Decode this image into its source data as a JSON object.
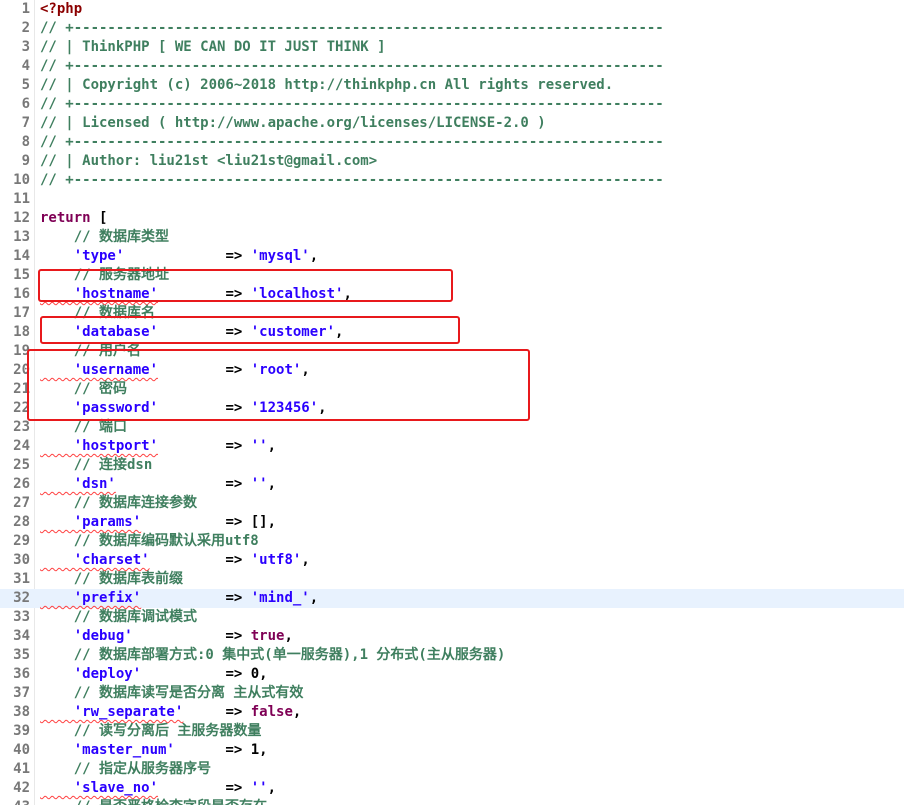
{
  "editor": {
    "current_line": 32,
    "lines": [
      {
        "n": "1",
        "t": [
          {
            "c": "php",
            "v": "<?php"
          }
        ]
      },
      {
        "n": "2",
        "t": [
          {
            "c": "com",
            "v": "// +----------------------------------------------------------------------"
          }
        ]
      },
      {
        "n": "3",
        "t": [
          {
            "c": "com",
            "v": "// | ThinkPHP [ WE CAN DO IT JUST THINK ]"
          }
        ]
      },
      {
        "n": "4",
        "t": [
          {
            "c": "com",
            "v": "// +----------------------------------------------------------------------"
          }
        ]
      },
      {
        "n": "5",
        "t": [
          {
            "c": "com",
            "v": "// | Copyright (c) 2006~2018 http://thinkphp.cn All rights reserved."
          }
        ]
      },
      {
        "n": "6",
        "t": [
          {
            "c": "com",
            "v": "// +----------------------------------------------------------------------"
          }
        ]
      },
      {
        "n": "7",
        "t": [
          {
            "c": "com",
            "v": "// | Licensed ( http://www.apache.org/licenses/LICENSE-2.0 )"
          }
        ]
      },
      {
        "n": "8",
        "t": [
          {
            "c": "com",
            "v": "// +----------------------------------------------------------------------"
          }
        ]
      },
      {
        "n": "9",
        "t": [
          {
            "c": "com",
            "v": "// | Author: liu21st <liu21st@gmail.com>"
          }
        ]
      },
      {
        "n": "10",
        "t": [
          {
            "c": "com",
            "v": "// +----------------------------------------------------------------------"
          }
        ]
      },
      {
        "n": "11",
        "t": []
      },
      {
        "n": "12",
        "t": [
          {
            "c": "kw",
            "v": "return"
          },
          {
            "c": "pl",
            "v": " ["
          }
        ]
      },
      {
        "n": "13",
        "t": [
          {
            "c": "com",
            "v": "    // 数据库类型"
          }
        ]
      },
      {
        "n": "14",
        "t": [
          {
            "c": "str",
            "v": "    'type'"
          },
          {
            "c": "op",
            "v": "            => "
          },
          {
            "c": "str",
            "v": "'mysql'"
          },
          {
            "c": "pl",
            "v": ","
          }
        ]
      },
      {
        "n": "15",
        "t": [
          {
            "c": "com",
            "v": "    // 服务器地址"
          }
        ]
      },
      {
        "n": "16",
        "t": [
          {
            "c": "str",
            "v": "    'hostname'"
          },
          {
            "c": "op",
            "v": "        => "
          },
          {
            "c": "str",
            "v": "'localhost'"
          },
          {
            "c": "pl",
            "v": ","
          }
        ]
      },
      {
        "n": "17",
        "t": [
          {
            "c": "com",
            "v": "    // 数据库名"
          }
        ]
      },
      {
        "n": "18",
        "t": [
          {
            "c": "str",
            "v": "    'database'"
          },
          {
            "c": "op",
            "v": "        => "
          },
          {
            "c": "str",
            "v": "'customer'"
          },
          {
            "c": "pl",
            "v": ","
          }
        ]
      },
      {
        "n": "19",
        "t": [
          {
            "c": "com",
            "v": "    // 用户名"
          }
        ]
      },
      {
        "n": "20",
        "t": [
          {
            "c": "str",
            "v": "    'username'"
          },
          {
            "c": "op",
            "v": "        => "
          },
          {
            "c": "str",
            "v": "'root'"
          },
          {
            "c": "pl",
            "v": ","
          }
        ]
      },
      {
        "n": "21",
        "t": [
          {
            "c": "com",
            "v": "    // 密码"
          }
        ]
      },
      {
        "n": "22",
        "t": [
          {
            "c": "str",
            "v": "    'password'"
          },
          {
            "c": "op",
            "v": "        => "
          },
          {
            "c": "str",
            "v": "'123456'"
          },
          {
            "c": "pl",
            "v": ","
          }
        ]
      },
      {
        "n": "23",
        "t": [
          {
            "c": "com",
            "v": "    // 端口"
          }
        ]
      },
      {
        "n": "24",
        "t": [
          {
            "c": "str",
            "v": "    'hostport'"
          },
          {
            "c": "op",
            "v": "        => "
          },
          {
            "c": "str",
            "v": "''"
          },
          {
            "c": "pl",
            "v": ","
          }
        ]
      },
      {
        "n": "25",
        "t": [
          {
            "c": "com",
            "v": "    // 连接dsn"
          }
        ]
      },
      {
        "n": "26",
        "t": [
          {
            "c": "str",
            "v": "    'dsn'"
          },
          {
            "c": "op",
            "v": "             => "
          },
          {
            "c": "str",
            "v": "''"
          },
          {
            "c": "pl",
            "v": ","
          }
        ]
      },
      {
        "n": "27",
        "t": [
          {
            "c": "com",
            "v": "    // 数据库连接参数"
          }
        ]
      },
      {
        "n": "28",
        "t": [
          {
            "c": "str",
            "v": "    'params'"
          },
          {
            "c": "op",
            "v": "          => "
          },
          {
            "c": "pl",
            "v": "[],"
          }
        ]
      },
      {
        "n": "29",
        "t": [
          {
            "c": "com",
            "v": "    // 数据库编码默认采用utf8"
          }
        ]
      },
      {
        "n": "30",
        "t": [
          {
            "c": "str",
            "v": "    'charset'"
          },
          {
            "c": "op",
            "v": "         => "
          },
          {
            "c": "str",
            "v": "'utf8'"
          },
          {
            "c": "pl",
            "v": ","
          }
        ]
      },
      {
        "n": "31",
        "t": [
          {
            "c": "com",
            "v": "    // 数据库表前缀"
          }
        ]
      },
      {
        "n": "32",
        "t": [
          {
            "c": "str",
            "v": "    'prefix'"
          },
          {
            "c": "op",
            "v": "          => "
          },
          {
            "c": "str",
            "v": "'mind_'"
          },
          {
            "c": "pl",
            "v": ","
          }
        ]
      },
      {
        "n": "33",
        "t": [
          {
            "c": "com",
            "v": "    // 数据库调试模式"
          }
        ]
      },
      {
        "n": "34",
        "t": [
          {
            "c": "str",
            "v": "    'debug'"
          },
          {
            "c": "op",
            "v": "           => "
          },
          {
            "c": "kw",
            "v": "true"
          },
          {
            "c": "pl",
            "v": ","
          }
        ]
      },
      {
        "n": "35",
        "t": [
          {
            "c": "com",
            "v": "    // 数据库部署方式:0 集中式(单一服务器),1 分布式(主从服务器)"
          }
        ]
      },
      {
        "n": "36",
        "t": [
          {
            "c": "str",
            "v": "    'deploy'"
          },
          {
            "c": "op",
            "v": "          => "
          },
          {
            "c": "pl",
            "v": "0,"
          }
        ]
      },
      {
        "n": "37",
        "t": [
          {
            "c": "com",
            "v": "    // 数据库读写是否分离 主从式有效"
          }
        ]
      },
      {
        "n": "38",
        "t": [
          {
            "c": "str",
            "v": "    'rw_separate'"
          },
          {
            "c": "op",
            "v": "     => "
          },
          {
            "c": "kw",
            "v": "false"
          },
          {
            "c": "pl",
            "v": ","
          }
        ]
      },
      {
        "n": "39",
        "t": [
          {
            "c": "com",
            "v": "    // 读写分离后 主服务器数量"
          }
        ]
      },
      {
        "n": "40",
        "t": [
          {
            "c": "str",
            "v": "    'master_num'"
          },
          {
            "c": "op",
            "v": "      => "
          },
          {
            "c": "pl",
            "v": "1,"
          }
        ]
      },
      {
        "n": "41",
        "t": [
          {
            "c": "com",
            "v": "    // 指定从服务器序号"
          }
        ]
      },
      {
        "n": "42",
        "t": [
          {
            "c": "str",
            "v": "    'slave_no'"
          },
          {
            "c": "op",
            "v": "        => "
          },
          {
            "c": "str",
            "v": "''"
          },
          {
            "c": "pl",
            "v": ","
          }
        ]
      },
      {
        "n": "43",
        "t": [
          {
            "c": "com",
            "v": "    // 是否严格检查字段是否存在"
          }
        ]
      }
    ]
  },
  "colors": {
    "highlight_box": "#e8191c",
    "current_line_bg": "#e8f2fe",
    "comment": "#3f7f5f",
    "string": "#2a00ff",
    "keyword": "#7f0055"
  }
}
